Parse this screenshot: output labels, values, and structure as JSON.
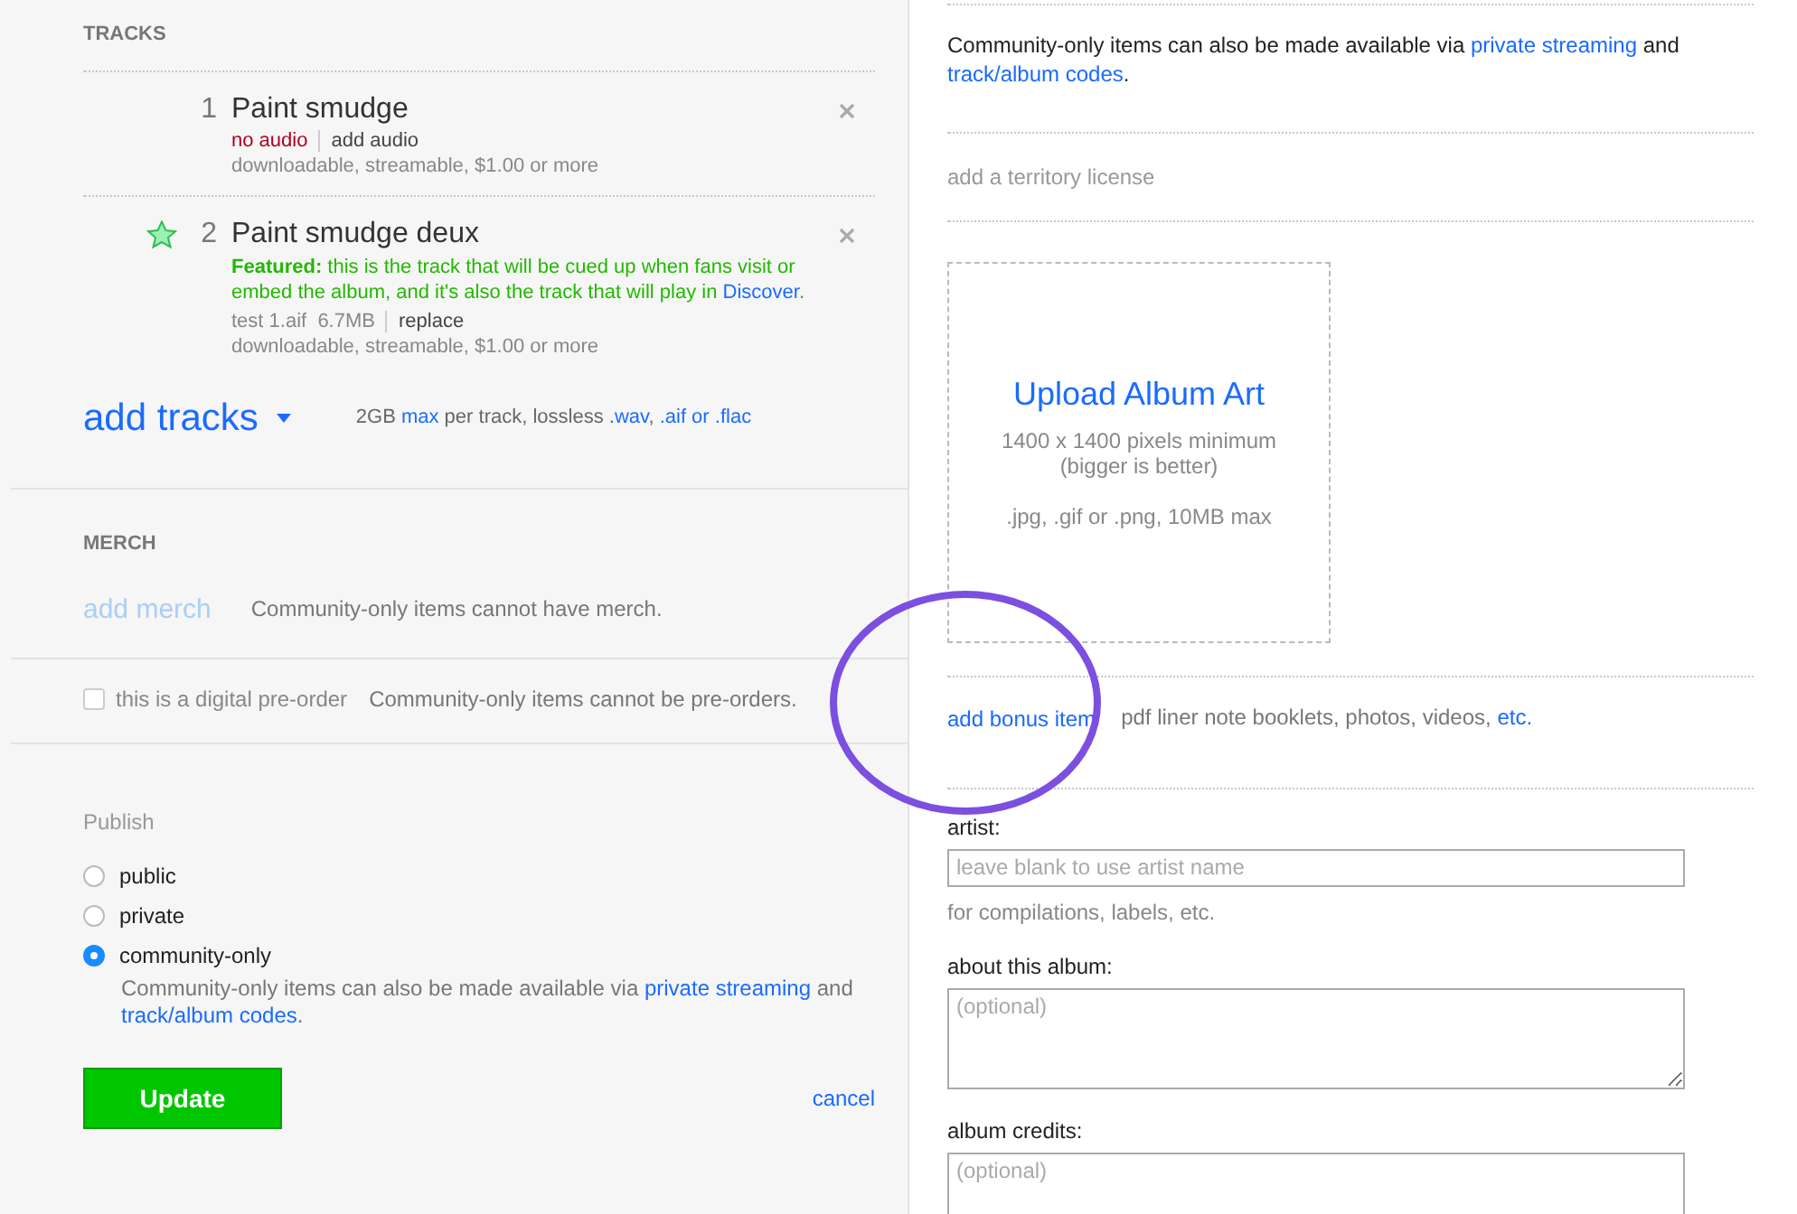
{
  "tracks": {
    "heading": "TRACKS",
    "items": [
      {
        "number": "1",
        "title": "Paint smudge",
        "featured": false,
        "status": [
          {
            "text": "no audio",
            "kind": "error"
          },
          {
            "text": "add audio",
            "kind": "action"
          }
        ],
        "info": "downloadable, streamable, $1.00 or more"
      },
      {
        "number": "2",
        "title": "Paint smudge deux",
        "featured": true,
        "note": [
          {
            "text": "Featured:",
            "kind": "bold"
          },
          {
            "text": " this is the track that will be cued up when fans visit or embed the album, and it's also the track that will play in ",
            "kind": "plain"
          },
          {
            "text": "Discover",
            "kind": "link"
          },
          {
            "text": ".",
            "kind": "plain"
          }
        ],
        "status": [
          {
            "text": "test 1.aif  6.7MB",
            "kind": "file"
          },
          {
            "text": "replace",
            "kind": "action"
          }
        ],
        "info": "downloadable, streamable, $1.00 or more"
      }
    ],
    "add_label": "add tracks",
    "limits": [
      {
        "text": "2GB ",
        "kind": "plain"
      },
      {
        "text": "max",
        "kind": "link"
      },
      {
        "text": " per track, lossless ",
        "kind": "plain"
      },
      {
        "text": ".wav",
        "kind": "link"
      },
      {
        "text": ", ",
        "kind": "plain"
      },
      {
        "text": ".aif or .flac",
        "kind": "link"
      }
    ]
  },
  "merch": {
    "heading": "MERCH",
    "add_label": "add merch",
    "disabled": true,
    "note": "Community-only items cannot have merch."
  },
  "preorder": {
    "label": "this is a digital pre-order",
    "checked": false,
    "note": "Community-only items cannot be pre-orders."
  },
  "publish": {
    "heading": "Publish",
    "options": [
      {
        "label": "public",
        "selected": false
      },
      {
        "label": "private",
        "selected": false
      },
      {
        "label": "community-only",
        "selected": true
      }
    ],
    "note": [
      {
        "text": "Community-only items can also be made available via ",
        "kind": "plain"
      },
      {
        "text": "private streaming",
        "kind": "link"
      },
      {
        "text": " and ",
        "kind": "plain"
      },
      {
        "text": "track/album codes",
        "kind": "link"
      },
      {
        "text": ".",
        "kind": "plain"
      }
    ]
  },
  "buttons": {
    "update": "Update",
    "cancel": "cancel"
  },
  "right": {
    "availability": [
      {
        "text": "Community-only items can also be made available via ",
        "kind": "plain"
      },
      {
        "text": "private streaming",
        "kind": "link"
      },
      {
        "text": " and ",
        "kind": "plain"
      },
      {
        "text": "track/album codes",
        "kind": "link"
      },
      {
        "text": ".",
        "kind": "plain"
      }
    ],
    "territory": "add a territory license",
    "upload": {
      "title": "Upload Album Art",
      "size": "1400 x 1400 pixels minimum",
      "hint": "(bigger is better)",
      "formats": ".jpg, .gif or .png, 10MB max"
    },
    "bonus": {
      "add_label": "add bonus item",
      "note": [
        {
          "text": "pdf liner note booklets, photos, videos, ",
          "kind": "plain"
        },
        {
          "text": "etc.",
          "kind": "link"
        }
      ]
    },
    "fields": [
      {
        "label": "artist:",
        "kind": "input",
        "placeholder": "leave blank to use artist name",
        "help": "for compilations, labels, etc."
      },
      {
        "label": "about this album:",
        "kind": "textarea",
        "placeholder": "(optional)"
      },
      {
        "label": "album credits:",
        "kind": "textarea",
        "placeholder": "(optional)"
      }
    ]
  }
}
